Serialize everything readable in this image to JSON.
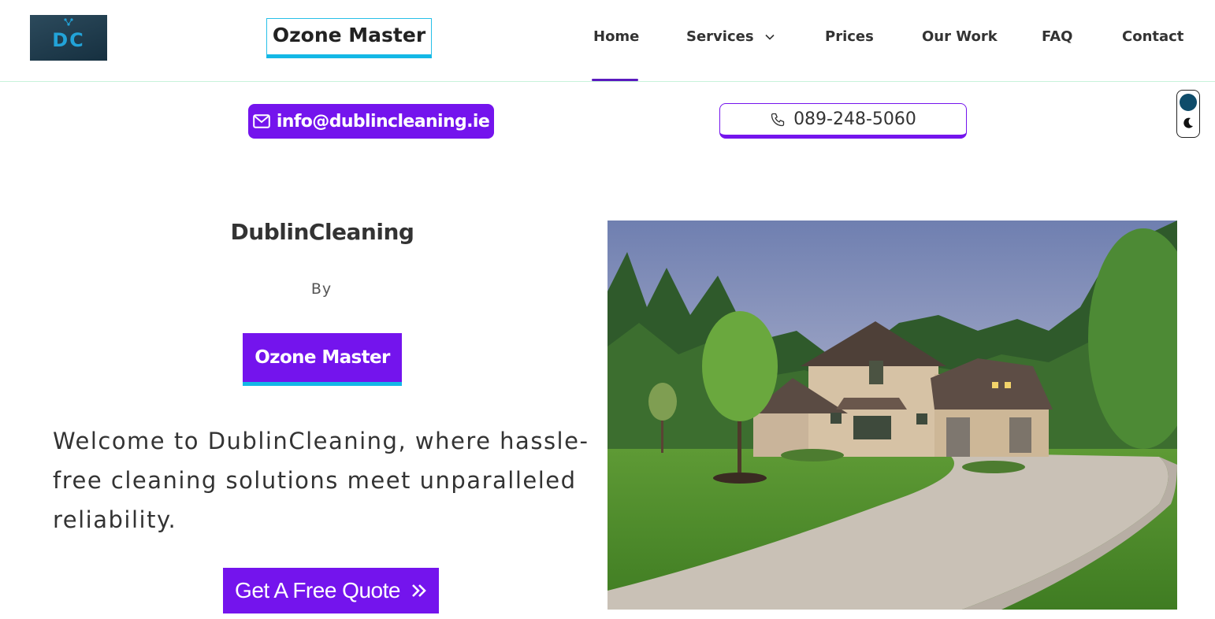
{
  "header": {
    "logo_text": "DC",
    "brand_label": "Ozone Master",
    "nav": [
      {
        "label": "Home",
        "active": true
      },
      {
        "label": "Services",
        "has_dropdown": true
      },
      {
        "label": "Prices"
      },
      {
        "label": "Our Work"
      },
      {
        "label": "FAQ"
      },
      {
        "label": "Contact"
      }
    ]
  },
  "contact_bar": {
    "email": "info@dublincleaning.ie",
    "phone": "089-248-5060",
    "email_icon": "mail-icon",
    "phone_icon": "phone-icon"
  },
  "theme_toggle": {
    "icon": "moon-icon"
  },
  "hero": {
    "title": "DublinCleaning",
    "by": "By",
    "brand_button": "Ozone Master",
    "welcome": "Welcome to DublinCleaning, where hassle-free cleaning solutions meet unparalleled reliability.",
    "cta_label": "Get A Free Quote",
    "cta_icon": "double-chevron-right-icon"
  },
  "colors": {
    "accent": "#7414ed",
    "cyan": "#14b8e6",
    "nav_active": "#5b1bbf",
    "toggle_dot": "#0f4c6a"
  }
}
